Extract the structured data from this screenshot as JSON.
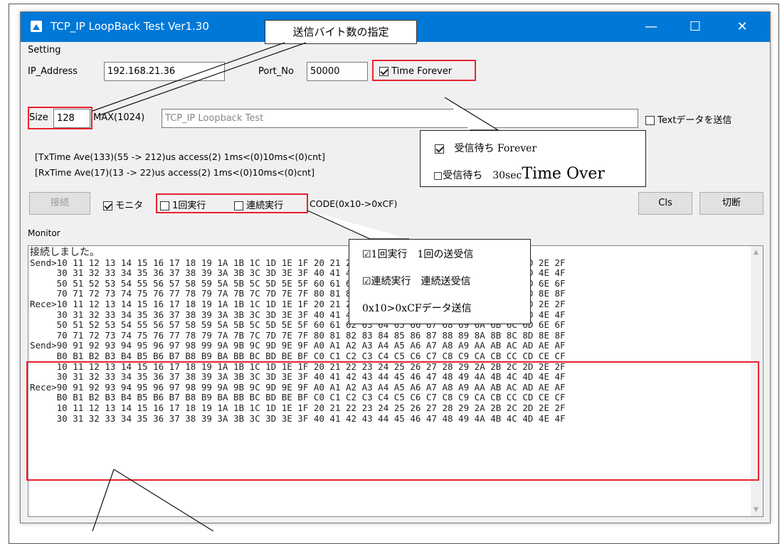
{
  "window": {
    "title": "TCP_IP LoopBack Test Ver1.30",
    "controls": [
      "—",
      "☐",
      "✕"
    ]
  },
  "setting": {
    "group_label": "Setting",
    "ip_label": "IP_Address",
    "ip_value": "192.168.21.36",
    "port_label": "Port_No",
    "port_value": "50000",
    "time_forever_label": "Time Forever",
    "size_label": "Size",
    "size_value": "128",
    "max_label": "MAX(1024)",
    "text_value": "TCP_IP Loopback Test",
    "text_send_label": "Textデータを送信"
  },
  "status": {
    "tx_line": "[TxTime Ave(133)(55 -> 212)us access(2) 1ms<(0)10ms<(0)cnt]",
    "rx_line": "[RxTime Ave(17)(13 -> 22)us access(2) 1ms<(0)10ms<(0)cnt]"
  },
  "controls_row": {
    "connect_label": "接続",
    "monitor_label": "モニタ",
    "once_label": "1回実行",
    "continuous_label": "連続実行",
    "code_label": "CODE(0x10->0xCF)",
    "cls_label": "Cls",
    "disconnect_label": "切断"
  },
  "monitor": {
    "label": "Monitor",
    "lines": [
      "接続しました。",
      "Send>10 11 12 13 14 15 16 17 18 19 1A 1B 1C 1D 1E 1F 20 21 22 23 24 25 26 27 28 29 2A 2B 2C 2D 2E 2F",
      "     30 31 32 33 34 35 36 37 38 39 3A 3B 3C 3D 3E 3F 40 41 42 43 44 45 46 47 48 49 4A 4B 4C 4D 4E 4F",
      "     50 51 52 53 54 55 56 57 58 59 5A 5B 5C 5D 5E 5F 60 61 62 63 64 65 66 67 68 69 6A 6B 6C 6D 6E 6F",
      "     70 71 72 73 74 75 76 77 78 79 7A 7B 7C 7D 7E 7F 80 81 82 83 84 85 86 87 88 89 8A 8B 8C 8D 8E 8F",
      "Rece>10 11 12 13 14 15 16 17 18 19 1A 1B 1C 1D 1E 1F 20 21 22 23 24 25 26 27 28 29 2A 2B 2C 2D 2E 2F",
      "     30 31 32 33 34 35 36 37 38 39 3A 3B 3C 3D 3E 3F 40 41 42 43 44 45 46 47 48 49 4A 4B 4C 4D 4E 4F",
      "     50 51 52 53 54 55 56 57 58 59 5A 5B 5C 5D 5E 5F 60 61 62 63 64 65 66 67 68 69 6A 6B 6C 6D 6E 6F",
      "     70 71 72 73 74 75 76 77 78 79 7A 7B 7C 7D 7E 7F 80 81 82 83 84 85 86 87 88 89 8A 8B 8C 8D 8E 8F",
      "Send>90 91 92 93 94 95 96 97 98 99 9A 9B 9C 9D 9E 9F A0 A1 A2 A3 A4 A5 A6 A7 A8 A9 AA AB AC AD AE AF",
      "     B0 B1 B2 B3 B4 B5 B6 B7 B8 B9 BA BB BC BD BE BF C0 C1 C2 C3 C4 C5 C6 C7 C8 C9 CA CB CC CD CE CF",
      "     10 11 12 13 14 15 16 17 18 19 1A 1B 1C 1D 1E 1F 20 21 22 23 24 25 26 27 28 29 2A 2B 2C 2D 2E 2F",
      "     30 31 32 33 34 35 36 37 38 39 3A 3B 3C 3D 3E 3F 40 41 42 43 44 45 46 47 48 49 4A 4B 4C 4D 4E 4F",
      "Rece>90 91 92 93 94 95 96 97 98 99 9A 9B 9C 9D 9E 9F A0 A1 A2 A3 A4 A5 A6 A7 A8 A9 AA AB AC AD AE AF",
      "     B0 B1 B2 B3 B4 B5 B6 B7 B8 B9 BA BB BC BD BE BF C0 C1 C2 C3 C4 C5 C6 C7 C8 C9 CA CB CC CD CE CF",
      "     10 11 12 13 14 15 16 17 18 19 1A 1B 1C 1D 1E 1F 20 21 22 23 24 25 26 27 28 29 2A 2B 2C 2D 2E 2F",
      "     30 31 32 33 34 35 36 37 38 39 3A 3B 3C 3D 3E 3F 40 41 42 43 44 45 46 47 48 49 4A 4B 4C 4D 4E 4F"
    ]
  },
  "annotations": {
    "size_callout": "送信バイト数の指定",
    "forever_line1": "受信待ち Forever",
    "forever_line2_prefix": "□受信待ち　30sec",
    "forever_line2_big": "Time Over",
    "exec_line1": "☑1回実行　1回の送受信",
    "exec_line2": "☑連続実行　連続送受信",
    "exec_line3": "0x10>0xCFデータ送信"
  },
  "colors": {
    "titlebar": "#0078d7",
    "highlight": "#e8232f"
  }
}
